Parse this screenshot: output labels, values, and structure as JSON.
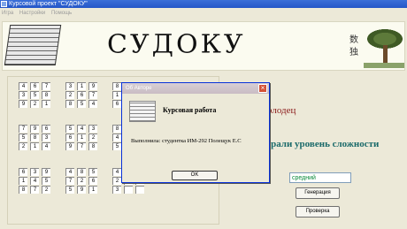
{
  "window": {
    "title": "Курсовой проект \"СУДОКУ\""
  },
  "menu": [
    "Игра",
    "Настройки",
    "Помощь"
  ],
  "banner": {
    "logo_text": "СУДОКУ",
    "kanji_top": "数",
    "kanji_bottom": "独"
  },
  "board": {
    "blocks": [
      {
        "cells": [
          "4",
          "6",
          "7",
          "3",
          "5",
          "8",
          "9",
          "2",
          "1"
        ]
      },
      {
        "cells": [
          "3",
          "1",
          "9",
          "2",
          "6",
          "7",
          "8",
          "5",
          "4"
        ]
      },
      {
        "cells": [
          "8",
          "2",
          "",
          "1",
          "3",
          "",
          "6",
          "7",
          ""
        ]
      },
      {
        "cells": [
          "7",
          "9",
          "6",
          "5",
          "8",
          "3",
          "2",
          "1",
          "4"
        ]
      },
      {
        "cells": [
          "5",
          "4",
          "3",
          "6",
          "1",
          "2",
          "9",
          "7",
          "8"
        ]
      },
      {
        "cells": [
          "8",
          "",
          "",
          "4",
          "",
          "",
          "5",
          "",
          ""
        ]
      },
      {
        "cells": [
          "6",
          "3",
          "9",
          "1",
          "4",
          "5",
          "8",
          "7",
          "2"
        ]
      },
      {
        "cells": [
          "4",
          "8",
          "5",
          "7",
          "2",
          "6",
          "5",
          "9",
          "1"
        ]
      },
      {
        "cells": [
          "4",
          "",
          "",
          "2",
          "",
          "",
          "3",
          "",
          ""
        ]
      }
    ]
  },
  "right_panel": {
    "congrats_fragment": "олодец",
    "level_fragment": "ыбрали уровень сложности",
    "level_value": "средний",
    "generate_label": "Генерация",
    "check_label": "Проверка"
  },
  "dialog": {
    "title": "Об Авторе",
    "heading": "Курсовая работа",
    "text": "Выполнила: студентка ИМ-292 Полещук Е.С",
    "ok_label": "OK",
    "close_glyph": "×"
  }
}
